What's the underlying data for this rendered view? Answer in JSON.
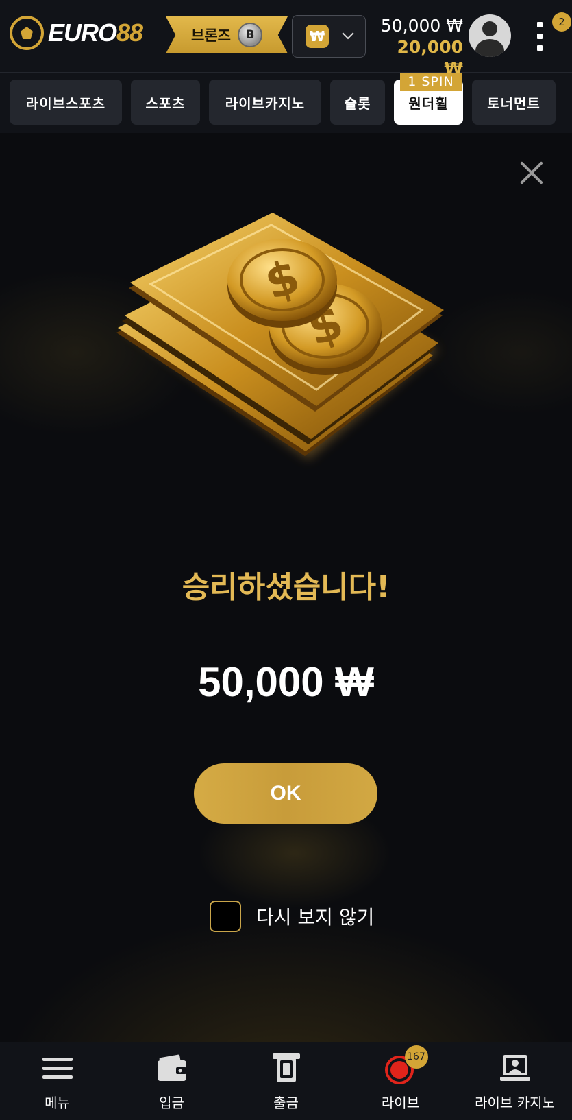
{
  "header": {
    "logo_text_white": "EURO",
    "logo_text_gold": "88",
    "rank_label": "브론즈",
    "rank_badge": "B",
    "currency_symbol": "₩",
    "balance_main": "50,000 ₩",
    "balance_bonus": "20,000 ₩",
    "notification_count": "2"
  },
  "tabs": [
    {
      "label": "라이브스포츠"
    },
    {
      "label": "스포츠"
    },
    {
      "label": "라이브카지노"
    },
    {
      "label": "슬롯"
    },
    {
      "label": "원더휠",
      "active": true,
      "tag": "1 SPIN"
    },
    {
      "label": "토너먼트"
    }
  ],
  "modal": {
    "title": "승리하셨습니다!",
    "amount": "50,000 ₩",
    "ok_label": "OK",
    "dont_show_label": "다시 보지 않기"
  },
  "bottom_nav": [
    {
      "label": "메뉴",
      "icon": "menu-icon"
    },
    {
      "label": "입금",
      "icon": "wallet-icon"
    },
    {
      "label": "출금",
      "icon": "atm-withdraw-icon"
    },
    {
      "label": "라이브",
      "icon": "live-record-icon",
      "badge": "167"
    },
    {
      "label": "라이브 카지노",
      "icon": "live-dealer-icon"
    }
  ],
  "colors": {
    "accent_gold": "#d3a536",
    "background": "#0b0c0f",
    "panel": "#111318"
  }
}
